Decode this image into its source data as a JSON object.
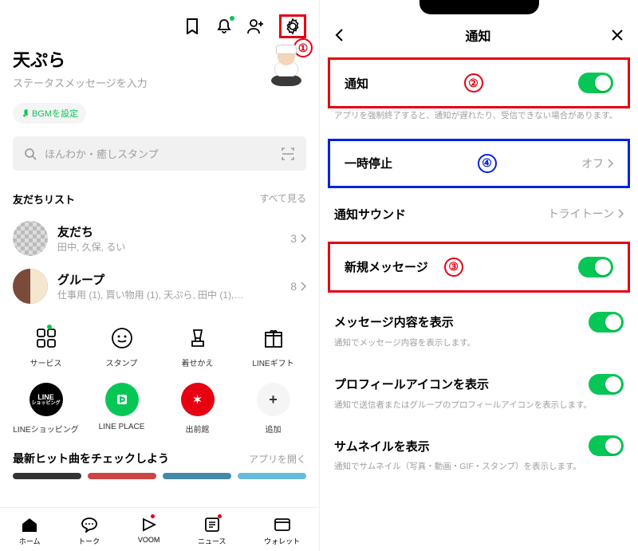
{
  "left": {
    "profile_name": "天ぷら",
    "status_placeholder": "ステータスメッセージを入力",
    "bgm_label": "BGMを設定",
    "search_placeholder": "ほんわか・癒しスタンプ",
    "friends_header": "友だちリスト",
    "see_all": "すべて見る",
    "friends": {
      "title": "友だち",
      "subtitle": "田中, 久保, るい",
      "count": "3"
    },
    "groups": {
      "title": "グループ",
      "subtitle": "仕事用 (1), 買い物用 (1), 天ぷら, 田中 (1),…",
      "count": "8"
    },
    "grid1": [
      {
        "label": "サービス"
      },
      {
        "label": "スタンプ"
      },
      {
        "label": "着せかえ"
      },
      {
        "label": "LINEギフト"
      }
    ],
    "grid2": [
      {
        "label": "LINEショッピング",
        "sub": "LINE",
        "sub2": "ショッピング"
      },
      {
        "label": "LINE PLACE"
      },
      {
        "label": "出前館"
      },
      {
        "label": "追加"
      }
    ],
    "hits_title": "最新ヒット曲をチェックしよう",
    "hits_open": "アプリを開く",
    "nav": [
      {
        "label": "ホーム"
      },
      {
        "label": "トーク"
      },
      {
        "label": "VOOM"
      },
      {
        "label": "ニュース"
      },
      {
        "label": "ウォレット"
      }
    ]
  },
  "right": {
    "title": "通知",
    "rows": {
      "notify": {
        "label": "通知",
        "caption": "アプリを強制終了すると、通知が遅れたり、受信できない場合があります。"
      },
      "pause": {
        "label": "一時停止",
        "value": "オフ"
      },
      "sound": {
        "label": "通知サウンド",
        "value": "トライトーン"
      },
      "newmsg": {
        "label": "新規メッセージ"
      },
      "content": {
        "label": "メッセージ内容を表示",
        "caption": "通知でメッセージ内容を表示します。"
      },
      "profile": {
        "label": "プロフィールアイコンを表示",
        "caption": "通知で送信者またはグループのプロフィールアイコンを表示します。"
      },
      "thumb": {
        "label": "サムネイルを表示",
        "caption": "通知でサムネイル（写真・動画・GIF・スタンプ）を表示します。"
      }
    }
  },
  "annotations": {
    "n1": "①",
    "n2": "②",
    "n3": "③",
    "n4": "④"
  }
}
